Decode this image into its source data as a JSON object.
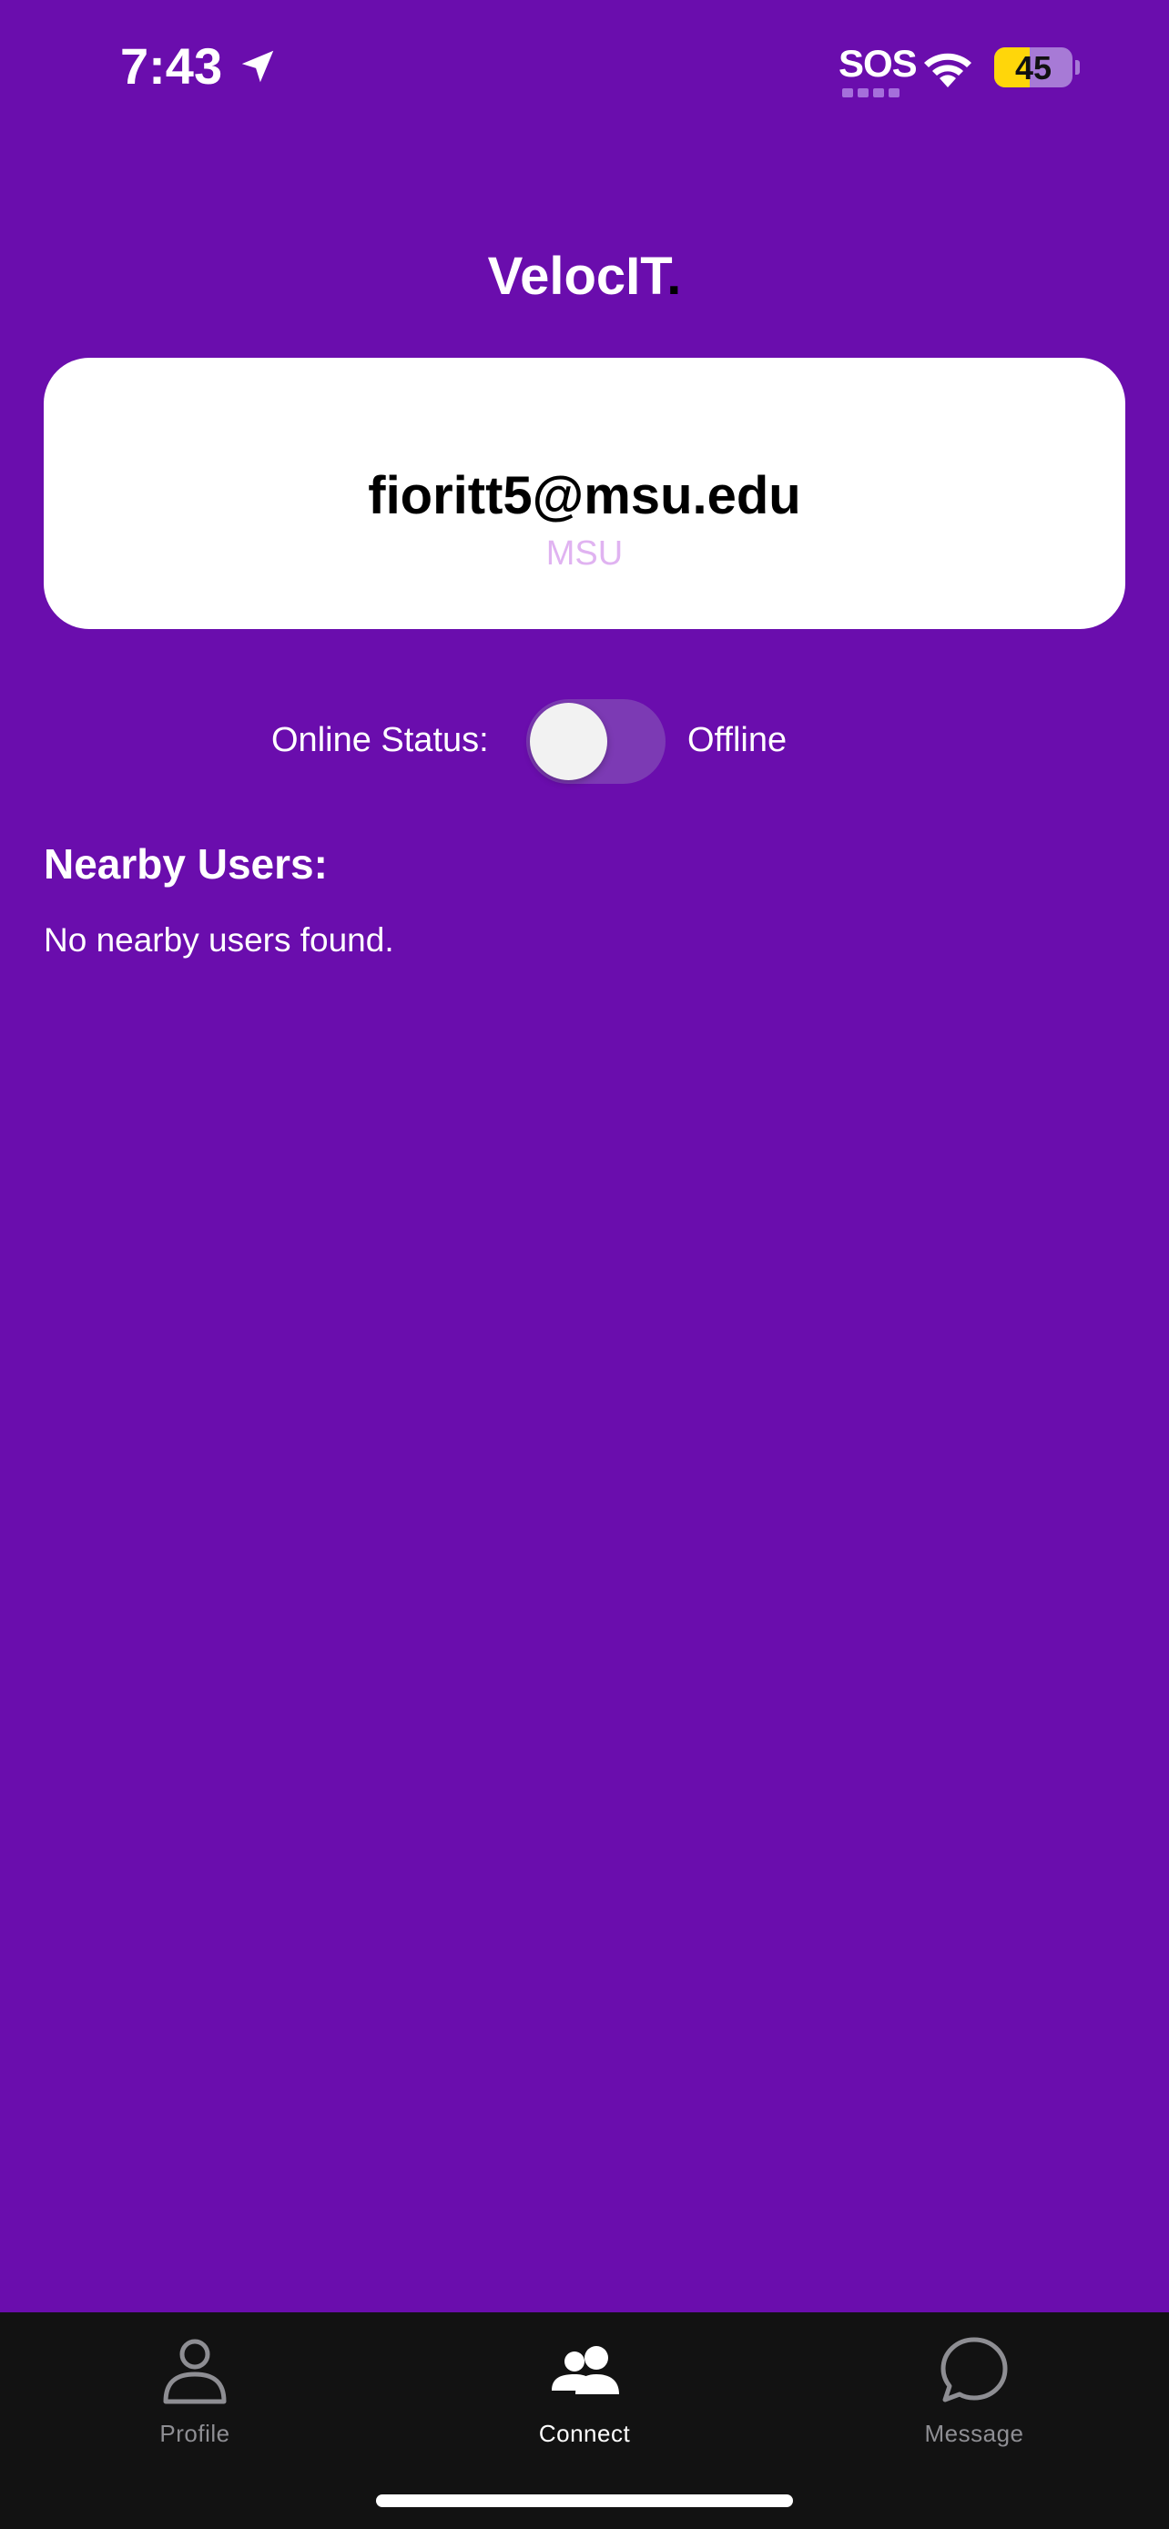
{
  "status_bar": {
    "time": "7:43",
    "sos": "SOS",
    "battery": "45",
    "battery_level": 0.45,
    "icons": [
      "location-arrow-icon",
      "wifi-icon",
      "battery-charging-icon"
    ]
  },
  "header": {
    "title": "VelocIT",
    "title_dot": "."
  },
  "profile_card": {
    "email": "fioritt5@msu.edu",
    "school": "MSU"
  },
  "online_status": {
    "label": "Online Status:",
    "value": "Offline",
    "enabled": false
  },
  "nearby": {
    "title": "Nearby Users:",
    "empty_message": "No nearby users found."
  },
  "tabs": [
    {
      "label": "Profile",
      "icon": "person-icon",
      "active": false
    },
    {
      "label": "Connect",
      "icon": "people-icon",
      "active": true
    },
    {
      "label": "Message",
      "icon": "chat-bubble-icon",
      "active": false
    }
  ],
  "colors": {
    "background": "#6a0dad",
    "card": "#ffffff",
    "school_text": "#e0b3f1",
    "tab_bar": "#121212",
    "tab_inactive": "#8e8e93",
    "battery_fill": "#ffd60a"
  }
}
